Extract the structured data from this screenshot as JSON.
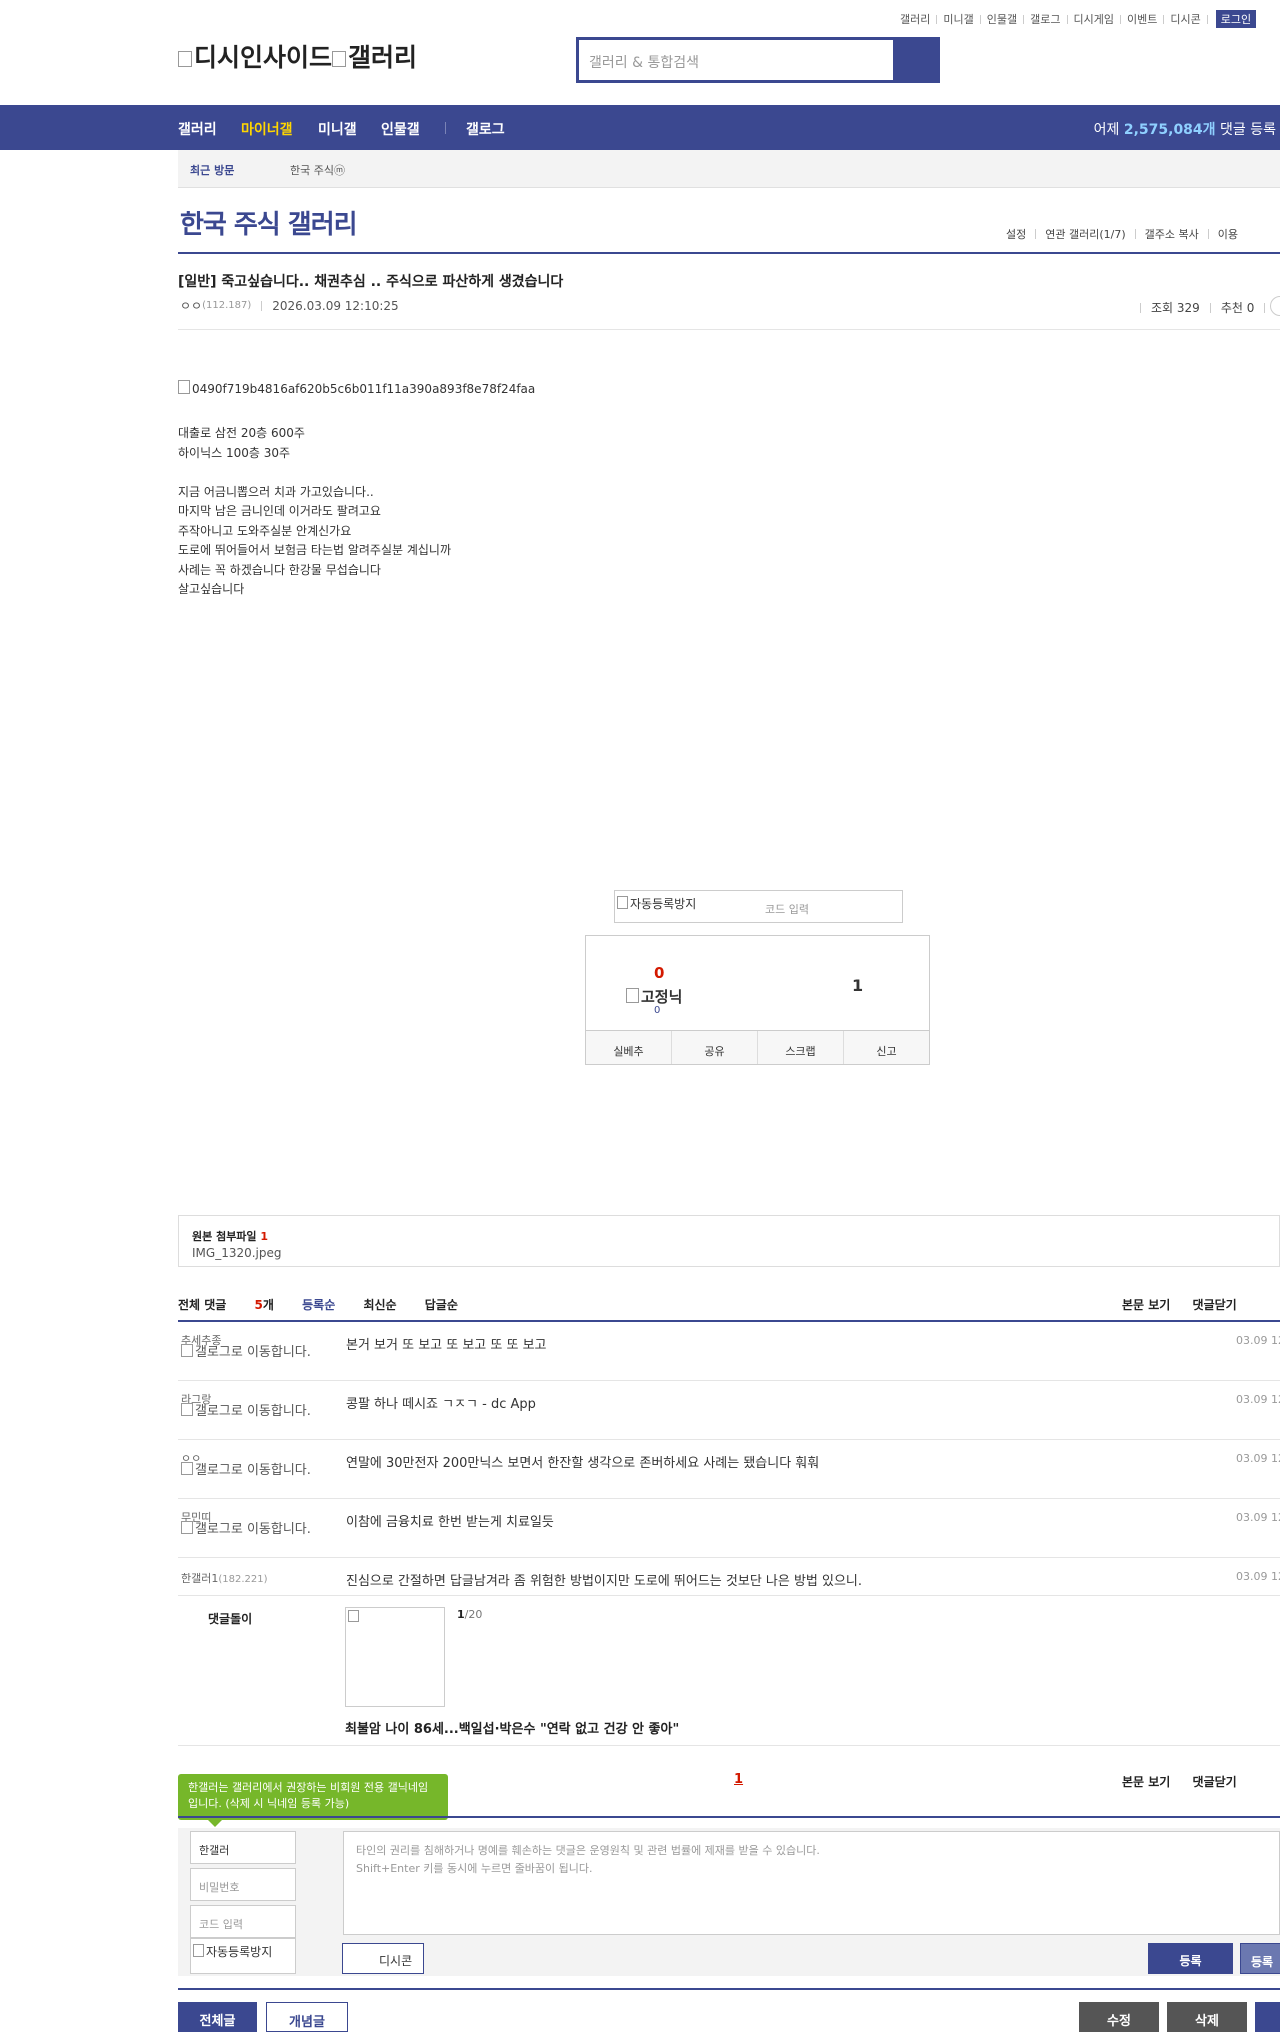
{
  "top_util": {
    "links": [
      "갤러리",
      "미니갤",
      "인물갤",
      "갤로그",
      "디시게임",
      "이벤트",
      "디시콘"
    ],
    "login": "로그인"
  },
  "logo": {
    "site": "디시인사이드",
    "section": "갤러리"
  },
  "search": {
    "placeholder": "갤러리 & 통합검색"
  },
  "gnb": {
    "items": [
      "갤러리",
      "마이너갤",
      "미니갤",
      "인물갤",
      "갤로그"
    ],
    "active": "마이너갤",
    "stat_prefix": "어제",
    "stat_value": "2,575,084개",
    "stat_suffix": "댓글 등록"
  },
  "recent": {
    "label": "최근 방문",
    "item": "한국 주식ⓜ"
  },
  "gallery": {
    "title": "한국 주식 갤러리",
    "menu": [
      "설정",
      "연관 갤러리(1/7)",
      "갤주소 복사",
      "이용"
    ]
  },
  "post": {
    "title": "[일반] 죽고싶습니다.. 채권추심 .. 주식으로 파산하게 생겼습니다",
    "author": "ㅇㅇ",
    "author_ip": "(112.187)",
    "datetime": "2026.03.09 12:10:25",
    "views": "조회 329",
    "recommends": "추천 0",
    "image_alt": "0490f719b4816af620b5c6b011f11a390a893f8e78f24faa",
    "body_lines": [
      "대출로 삼전 20층 600주",
      "하이닉스 100층 30주",
      "",
      "지금 어금니뽑으러 치과 가고있습니다..",
      "마지막 남은 금니인데 이거라도 팔려고요",
      "주작아니고 도와주실분 안계신가요",
      "도로에 뛰어들어서 보험금 타는법 알려주실분 계십니까",
      "사례는 꼭 하겠습니다 한강물 무섭습니다",
      "살고싶습니다"
    ]
  },
  "vote": {
    "captcha_alt": "자동등록방지",
    "captcha_placeholder": "코드 입력",
    "up_count": "0",
    "fixed_nick_alt": "고정닉",
    "fixed_count": "0",
    "down_count": "1",
    "actions": [
      "실베추",
      "공유",
      "스크랩",
      "신고"
    ]
  },
  "attachment": {
    "label": "원본 첨부파일",
    "count": "1",
    "file": "IMG_1320.jpeg"
  },
  "comments": {
    "label": "전체 댓글",
    "count": "5",
    "unit": "개",
    "sorts": [
      "등록순",
      "최신순",
      "답글순"
    ],
    "right_actions": [
      "본문 보기",
      "댓글닫기"
    ],
    "gallog_alt": "갤로그로 이동합니다.",
    "items": [
      {
        "nick": "추세추종",
        "ip": "",
        "text": "본거 보거 또 보고 또 보고 또 또 보고",
        "date": "03.09 12"
      },
      {
        "nick": "라그랑",
        "ip": "",
        "text": "콩팔 하나 떼시죠 ㄱㅈㄱ - dc App",
        "date": "03.09 12"
      },
      {
        "nick": "ㅇㅇ",
        "ip": "",
        "text": "연말에 30만전자 200만닉스 보면서 한잔할 생각으로 존버하세요 사례는 됐습니다 훠훠",
        "date": "03.09 12"
      },
      {
        "nick": "무민띠",
        "ip": "",
        "text": "이참에 금융치료 한번 받는게 치료일듯",
        "date": "03.09 12"
      },
      {
        "nick": "한갤러1",
        "ip": "(182.221)",
        "text": "진심으로 간절하면 답글남겨라 좀 위험한 방법이지만 도로에 뛰어드는 것보단 나은 방법 있으니.",
        "date": "03.09 12"
      }
    ]
  },
  "dol": {
    "label": "댓글돌이",
    "page_current": "1",
    "page_total": "/20",
    "news": "최불암 나이 86세...백일섭·박은수 \"연락 없고 건강 안 좋아\""
  },
  "pager": {
    "current": "1"
  },
  "write": {
    "tooltip": "한갤러는 갤러리에서 권장하는 비회원 전용 갤닉네임입니다. (삭제 시 닉네임 등록 가능)",
    "nick": "한갤러",
    "password_placeholder": "비밀번호",
    "code_placeholder": "코드 입력",
    "captcha_alt": "자동등록방지",
    "notice_1": "타인의 권리를 침해하거나 명예를 훼손하는 댓글은 운영원칙 및 관련 법률에 제재를 받을 수 있습니다.",
    "notice_2": "Shift+Enter 키를 동시에 누르면 줄바꿈이 됩니다.",
    "dccon": "디시콘",
    "submit": "등록",
    "submit2": "등록"
  },
  "bottom": {
    "all": "전체글",
    "concept": "개념글",
    "edit": "수정",
    "delete": "삭제"
  }
}
